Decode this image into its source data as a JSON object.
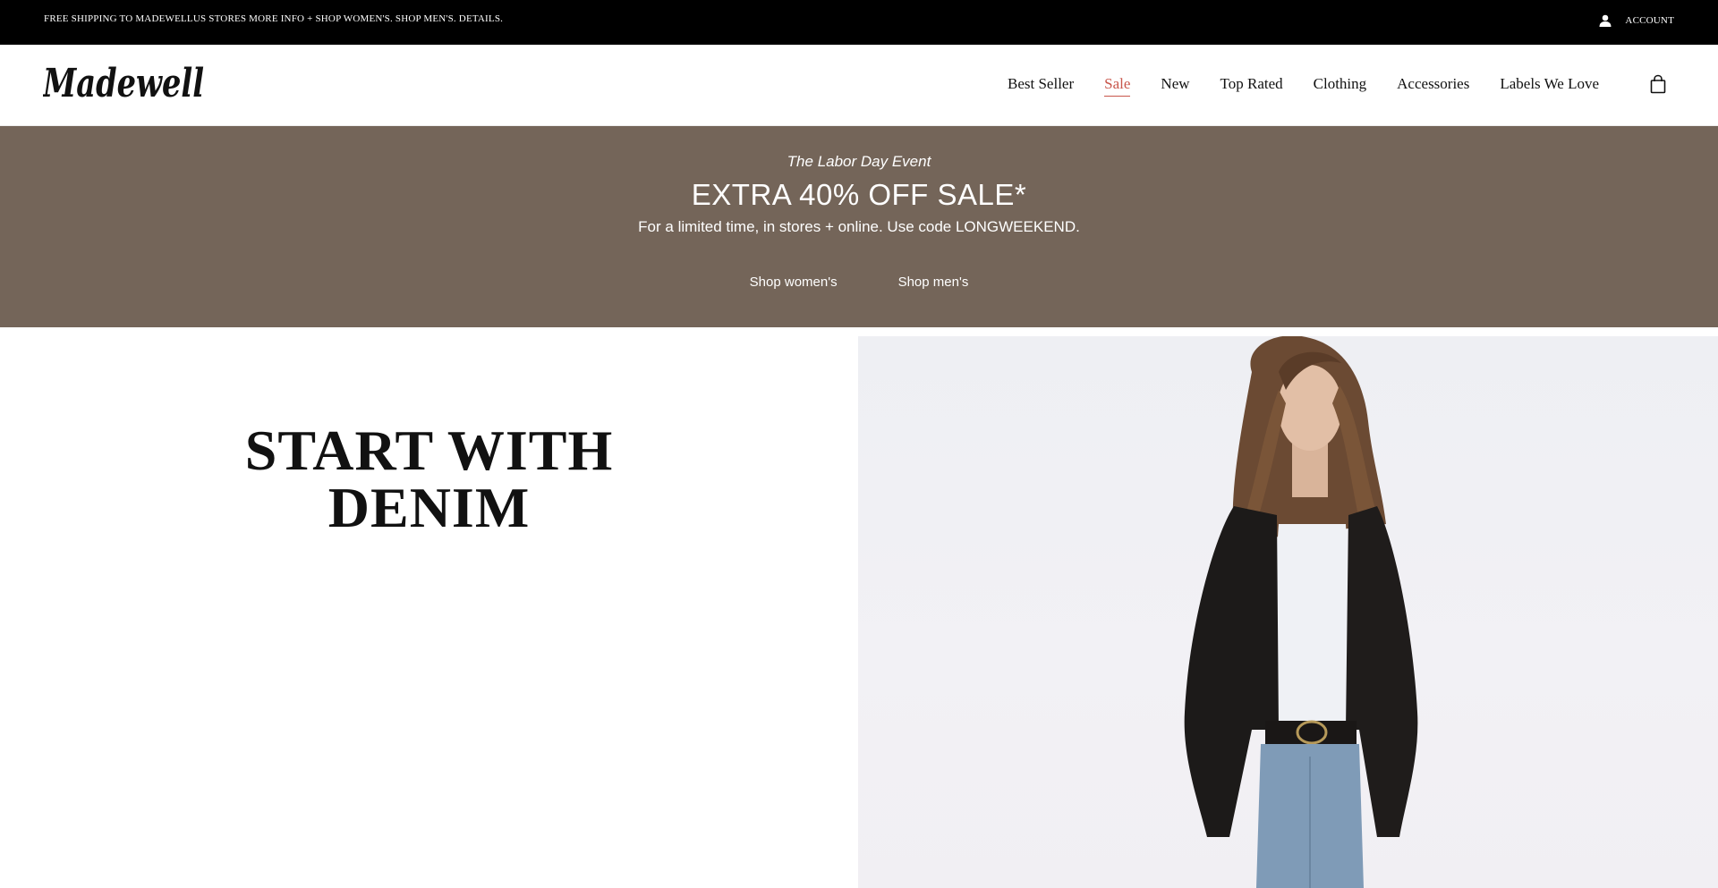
{
  "topbar": {
    "promo_text": "FREE SHIPPING TO MADEWELLUS STORES MORE INFO + SHOP WOMEN'S. SHOP MEN'S. DETAILS.",
    "account_label": "ACCOUNT",
    "account_icon": "user-icon"
  },
  "header": {
    "logo_text": "Madewell",
    "nav": [
      {
        "label": "Best Seller"
      },
      {
        "label": "Sale",
        "color": "#c8554a"
      },
      {
        "label": "New"
      },
      {
        "label": "Top Rated"
      },
      {
        "label": "Clothing"
      },
      {
        "label": "Accessories"
      },
      {
        "label": "Labels We Love"
      }
    ],
    "bag_icon": "shopping-bag-icon"
  },
  "banner": {
    "background": "#746559",
    "eyebrow": "The Labor Day Event",
    "headline": "EXTRA 40% OFF SALE*",
    "subtext": "For a limited time, in stores + online. Use code LONGWEEKEND.",
    "cta_women": "Shop women's",
    "cta_men": "Shop men's"
  },
  "hero": {
    "title_line1": "START WITH",
    "title_line2": "DENIM"
  }
}
